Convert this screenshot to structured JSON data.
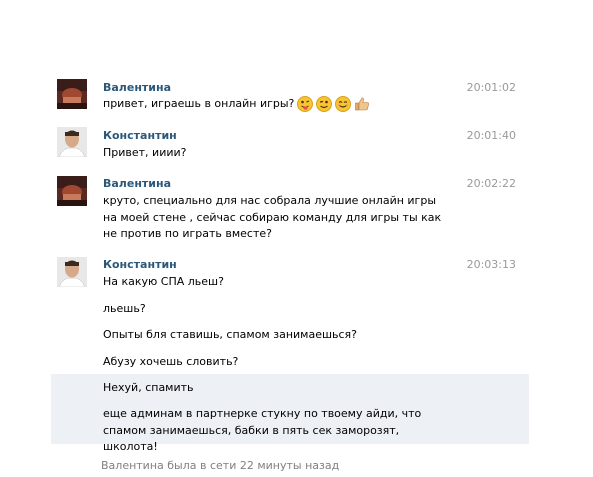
{
  "messages": [
    {
      "author": "Валентина",
      "time": "20:01:02",
      "texts": [
        "привет, играешь в онлайн игры?"
      ],
      "emojis": [
        "tongue-wink-emoji-icon",
        "wink-emoji-icon",
        "smile-emoji-icon",
        "thumbs-up-icon"
      ]
    },
    {
      "author": "Константин",
      "time": "20:01:40",
      "texts": [
        "Привет, ииии?"
      ]
    },
    {
      "author": "Валентина",
      "time": "20:02:22",
      "texts": [
        "круто, специально для нас собрала лучшие онлайн игры на моей стене , сейчас собираю команду для игры ты как не против по играть вместе?"
      ]
    },
    {
      "author": "Константин",
      "time": "20:03:13",
      "texts": [
        "На какую СПА льеш?",
        "льешь?",
        "Опыты бля ставишь, спамом занимаешься?",
        "Абузу хочешь словить?"
      ]
    },
    {
      "selected": true,
      "texts": [
        "Нехуй, спамить",
        "еще админам в партнерке стукну по твоему айди, что спамом занимаешься, бабки в пять сек заморозят, школота!"
      ]
    }
  ],
  "status": "Валентина была в сети 22 минуты назад",
  "colors": {
    "author": "#2b587a",
    "selected_bg": "#edf0f5",
    "time": "#9a9a9a"
  }
}
